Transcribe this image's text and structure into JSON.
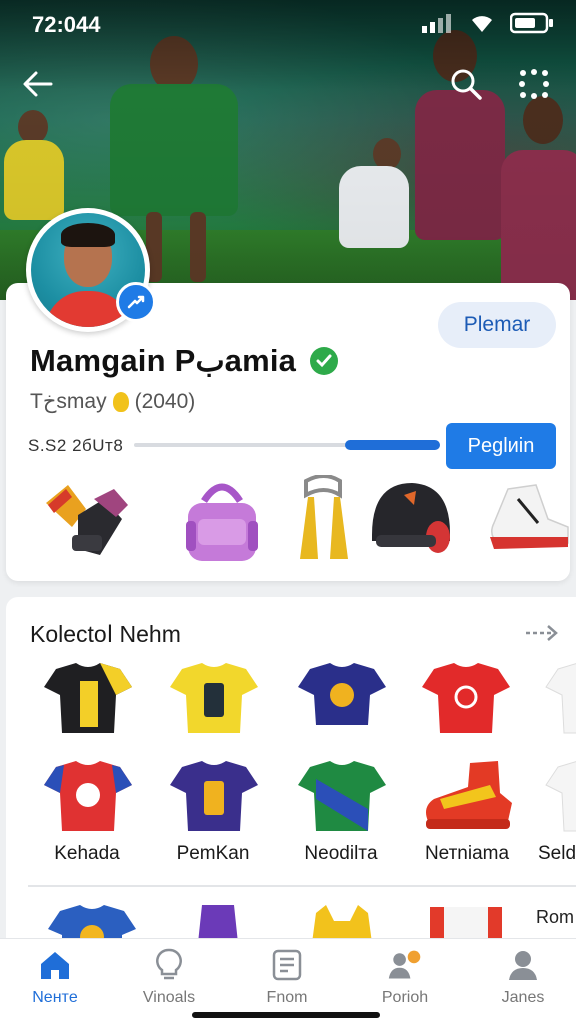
{
  "status_bar": {
    "time": "72:044"
  },
  "header": {
    "back_icon": "arrow-left-icon",
    "search_icon": "search-icon",
    "more_icon": "grid-more-icon"
  },
  "profile": {
    "follow_label": "Plemar",
    "name": "Mamgain Pبamia",
    "subtitle_prefix": "Tخsmay",
    "subtitle_year": "(2040)",
    "progress_label": "S.S2 2бUт8",
    "progress_fraction": 0.31,
    "action_label": "Peglиin",
    "gear": [
      "goalkeeper-glove",
      "bag",
      "whistle-lanyard",
      "helmet",
      "cleat"
    ]
  },
  "collection": {
    "title": "Kolectoا Nehm",
    "labels": [
      "Kehada",
      "PemKan",
      "Neodilтa",
      "Nетniama",
      "Seld"
    ],
    "peek_label": "Rom"
  },
  "bottom_nav": [
    {
      "label": "Neнтe",
      "icon": "home-icon",
      "active": true
    },
    {
      "label": "Vinoals",
      "icon": "bulb-icon",
      "active": false
    },
    {
      "label": "Fnom",
      "icon": "list-icon",
      "active": false
    },
    {
      "label": "Porioh",
      "icon": "team-icon",
      "active": false
    },
    {
      "label": "Janes",
      "icon": "user-icon",
      "active": false
    }
  ],
  "colors": {
    "accent": "#1f7be6",
    "verified": "#2eaa4a",
    "hero": "#15664f"
  }
}
